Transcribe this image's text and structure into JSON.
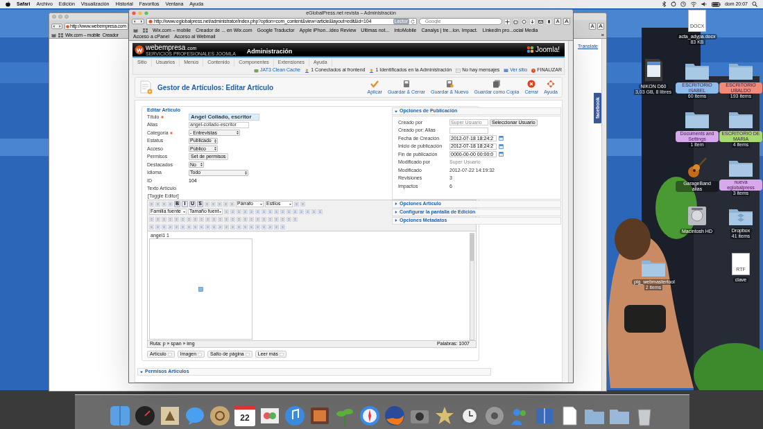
{
  "menubar": {
    "app": "Safari",
    "items": [
      "Archivo",
      "Edición",
      "Visualización",
      "Historial",
      "Favoritos",
      "Ventana",
      "Ayuda"
    ],
    "clock": "dom 20:07"
  },
  "back_window": {
    "address": "http://www.webempresa.com",
    "bookmarks": [
      "Wix.com – mobile",
      "Creador"
    ],
    "text_size_buttons": [
      "A",
      "A"
    ],
    "more": "»",
    "translate_link": "Translate",
    "facebook_tab": "facebook"
  },
  "window": {
    "title": "eGlobalPress.net revista – Administración",
    "address": "http://www.eglobalpress.net/administrator/index.php?option=com_content&view=article&layout=edit&id=104",
    "reader": "Lector",
    "search_placeholder": "Google",
    "text_size_buttons": [
      "A",
      "A"
    ],
    "bookmarks": [
      "Wix.com – mobile",
      "Creador de ... en Wix.com",
      "Google Traductor",
      "Apple iPhon...ideo Review",
      "Ultimas not...",
      "IntoMobile",
      "Canalys | tre...ion. Impact.",
      "LinkedIn pro...ocial Media",
      "Acceso a cPanel",
      "Acceso al Webmail"
    ]
  },
  "joomla": {
    "brand": "webempresa",
    "brand_suffix": ".com",
    "tagline": "SERVICIOS PROFESIONALES JOOMLA",
    "header_title": "Administración",
    "cms_logo": "Joomla!",
    "menu": [
      "Sitio",
      "Usuarios",
      "Menús",
      "Contenido",
      "Componentes",
      "Extensiones",
      "Ayuda"
    ],
    "status": [
      {
        "kind": "cache",
        "label": "JAT3 Clean Cache"
      },
      {
        "kind": "users",
        "label": "1 Conectados al frontend"
      },
      {
        "kind": "users",
        "label": "1 Identificados en la Administración"
      },
      {
        "kind": "messages",
        "label": "No hay mensajes"
      },
      {
        "kind": "site",
        "label": "Ver sitio"
      },
      {
        "kind": "logout",
        "label": "FINALIZAR"
      }
    ],
    "page_title": "Gestor de Artículos: Editar Artículo",
    "actions": [
      {
        "kind": "apply",
        "label": "Aplicar"
      },
      {
        "kind": "save",
        "label": "Guardar & Cerrar"
      },
      {
        "kind": "save-new",
        "label": "Guardar & Nuevo"
      },
      {
        "kind": "copy",
        "label": "Guardar como Copia"
      },
      {
        "kind": "close",
        "label": "Cerrar"
      },
      {
        "kind": "help",
        "label": "Ayuda"
      }
    ],
    "legend": "Editar Artículo",
    "fields": [
      {
        "label": "Título",
        "required": true,
        "kind": "title",
        "value": "Angel Collado, escritor"
      },
      {
        "label": "Alias",
        "required": false,
        "kind": "input",
        "value": "angel-collado-escritor"
      },
      {
        "label": "Categoría",
        "required": true,
        "kind": "select",
        "value": "- Entrevistas"
      },
      {
        "label": "Estatus",
        "required": false,
        "kind": "select",
        "value": "Publicado"
      },
      {
        "label": "Acceso",
        "required": false,
        "kind": "select",
        "value": "Público"
      },
      {
        "label": "Permisos",
        "required": false,
        "kind": "button",
        "value": "Set de permisos"
      },
      {
        "label": "Destacados",
        "required": false,
        "kind": "select",
        "value": "No"
      },
      {
        "label": "Idioma",
        "required": false,
        "kind": "select",
        "value": "Todo"
      },
      {
        "label": "ID",
        "required": false,
        "kind": "text",
        "value": "104"
      },
      {
        "label": "Texto Artículo",
        "required": false,
        "kind": "none"
      }
    ],
    "toggle_editor": "[Toggle Editor]",
    "editor": {
      "style_buttons": [
        "B",
        "I",
        "U",
        "S"
      ],
      "format": "Párrafo",
      "styles": "Estilos",
      "font_family": "Familia fuente",
      "font_size": "Tamaño fuent",
      "content": "angel1 1",
      "path": "Ruta: p » span » img",
      "word_count": "Palabras: 1007"
    },
    "insert_buttons": [
      "Artículo",
      "Imagen",
      "Salto de página",
      "Leer más"
    ],
    "panels": [
      {
        "title": "Opciones de Publicación",
        "expanded": true,
        "fields": [
          {
            "label": "Creado por",
            "kind": "user",
            "value": "Super Usuario",
            "button": "Seleccionar Usuario"
          },
          {
            "label": "Creado por: Alias",
            "kind": "input"
          },
          {
            "label": "Fecha de Creación",
            "kind": "date",
            "value": "2012-07-18 18:24:2"
          },
          {
            "label": "Inicio de publicación",
            "kind": "date",
            "value": "2012-07-18 18:24:2"
          },
          {
            "label": "Fin de publicación",
            "kind": "date",
            "value": "0000-00-00 00:00:0"
          },
          {
            "label": "Modificado por",
            "kind": "muted",
            "value": "Super Usuario"
          },
          {
            "label": "Modificado",
            "kind": "text",
            "value": "2012-07-22 14:19:32"
          },
          {
            "label": "Revisiones",
            "kind": "text",
            "value": "3"
          },
          {
            "label": "Impactos",
            "kind": "text",
            "value": "6"
          }
        ]
      },
      {
        "title": "Opciones Artículo",
        "expanded": false
      },
      {
        "title": "Configurar la pantalla de Edición",
        "expanded": false
      },
      {
        "title": "Opciones Metadatos",
        "expanded": false
      }
    ],
    "permissions_panel": {
      "title": "Permisos Artículos",
      "expanded": true
    }
  },
  "desktop_icons": [
    {
      "kind": "document",
      "badge": "DOCX",
      "label": "acta_adypa.docx",
      "detail": "83 KB"
    },
    {
      "kind": "sdcard",
      "label": "NIKON D60",
      "detail": "3,03 GB, 8 libres"
    },
    {
      "kind": "folder",
      "label": "ESCRITORIO ISABEL",
      "detail": "60 items",
      "color": "#8cbcec"
    },
    {
      "kind": "folder",
      "label": "ESCRITORIO UBALDO",
      "detail": "193 items",
      "color": "#f28a78"
    },
    {
      "kind": "folder",
      "label": "Documents and Settings",
      "detail": "1 item",
      "color": "#d8a8ec"
    },
    {
      "kind": "folder",
      "label": "ESCRITORIO DE MARIA",
      "detail": "4 items",
      "color": "#a8da72"
    },
    {
      "kind": "guitar",
      "label": "GarageBand alias"
    },
    {
      "kind": "folder",
      "label": "nueva eglobalpress",
      "detail": "3 items",
      "color": "#d8a8ec"
    },
    {
      "kind": "drive",
      "label": "Macintosh HD"
    },
    {
      "kind": "dropbox",
      "label": "Dropbox",
      "detail": "41 items"
    },
    {
      "kind": "folder",
      "label": "plg_webmastertool",
      "detail": "2 items"
    },
    {
      "kind": "document",
      "badge": "RTF",
      "label": "clave"
    }
  ],
  "dock": {
    "calendar_day": "22"
  }
}
